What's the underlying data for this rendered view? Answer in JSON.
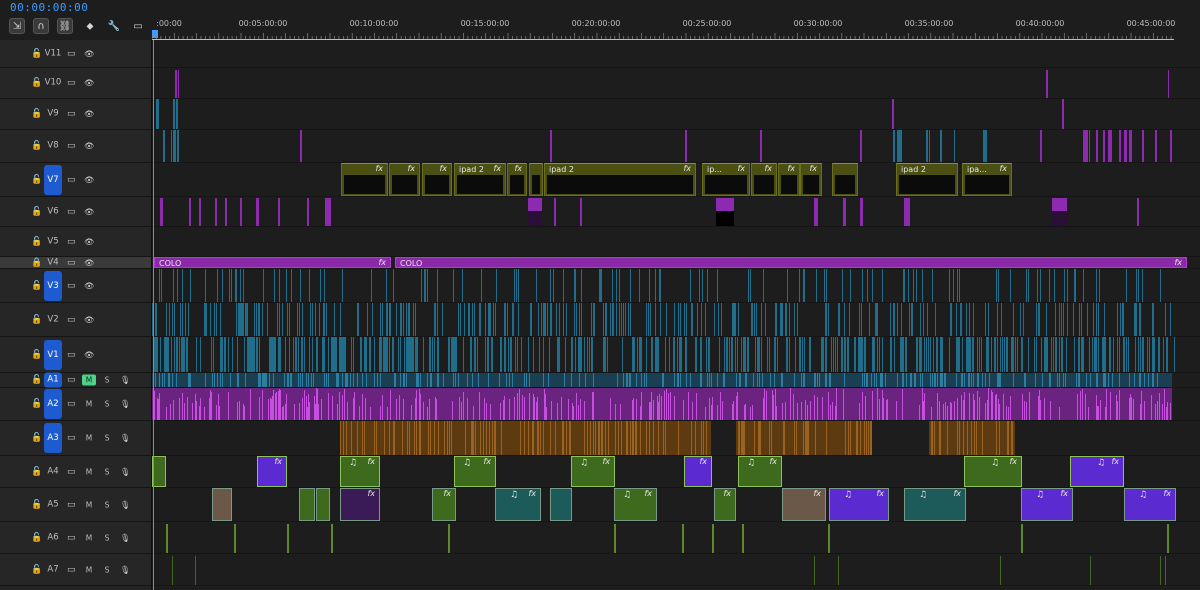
{
  "timecode": "00:00:00:00",
  "toolbar": {
    "tools": [
      {
        "name": "insert-sequence-nest-icon",
        "glyph": "⇲",
        "on": true
      },
      {
        "name": "snap-magnet-icon",
        "glyph": "∩",
        "on": true
      },
      {
        "name": "linked-selection-icon",
        "glyph": "⛓",
        "on": true
      },
      {
        "name": "add-marker-icon",
        "glyph": "⬥",
        "on": false
      },
      {
        "name": "timeline-settings-wrench-icon",
        "glyph": "🔧",
        "on": false
      },
      {
        "name": "captions-icon",
        "glyph": "▭",
        "on": false
      }
    ]
  },
  "ruler": {
    "labels": [
      ":00:00",
      "00:05:00:00",
      "00:10:00:00",
      "00:15:00:00",
      "00:20:00:00",
      "00:25:00:00",
      "00:30:00:00",
      "00:35:00:00",
      "00:40:00:00",
      "00:45:00:00"
    ]
  },
  "tracks": [
    {
      "id": "V11",
      "type": "video",
      "targeted": false,
      "locked": false
    },
    {
      "id": "V10",
      "type": "video",
      "targeted": false,
      "locked": false
    },
    {
      "id": "V9",
      "type": "video",
      "targeted": false,
      "locked": false
    },
    {
      "id": "V8",
      "type": "video",
      "targeted": false,
      "locked": false
    },
    {
      "id": "V7",
      "type": "video",
      "targeted": true,
      "locked": false
    },
    {
      "id": "V6",
      "type": "video",
      "targeted": false,
      "locked": false
    },
    {
      "id": "V5",
      "type": "video",
      "targeted": false,
      "locked": false
    },
    {
      "id": "V4",
      "type": "video",
      "targeted": false,
      "locked": true
    },
    {
      "id": "V3",
      "type": "video",
      "targeted": true,
      "locked": false
    },
    {
      "id": "V2",
      "type": "video",
      "targeted": false,
      "locked": false
    },
    {
      "id": "V1",
      "type": "video",
      "targeted": true,
      "locked": false
    },
    {
      "id": "A1",
      "type": "audio",
      "targeted": true,
      "muted": true
    },
    {
      "id": "A2",
      "type": "audio",
      "targeted": true,
      "muted": false
    },
    {
      "id": "A3",
      "type": "audio",
      "targeted": true,
      "muted": false
    },
    {
      "id": "A4",
      "type": "audio",
      "targeted": false,
      "muted": false
    },
    {
      "id": "A5",
      "type": "audio",
      "targeted": false,
      "muted": false
    },
    {
      "id": "A6",
      "type": "audio",
      "targeted": false,
      "muted": false
    },
    {
      "id": "A7",
      "type": "audio",
      "targeted": false,
      "muted": false
    }
  ],
  "audio_buttons": {
    "mute": "M",
    "solo": "S"
  },
  "clip_labels": {
    "fx": "fx",
    "ipad2": "ipad 2",
    "ip": "ip...",
    "ipa": "ipa...",
    "colo": "COLO",
    "music": "♫"
  },
  "colors": {
    "accent": "#3f9bff",
    "target": "#1e5bd1",
    "mute_on": "#4fd18a",
    "v7_clip": "#4b4f12",
    "v4_clip": "#8a2aa8",
    "purple": "#8c2ab0",
    "teal": "#1f6f8c",
    "brown": "#7a4a16",
    "green_audio": "#3d6a1d",
    "violet_audio": "#5b2bd1"
  }
}
